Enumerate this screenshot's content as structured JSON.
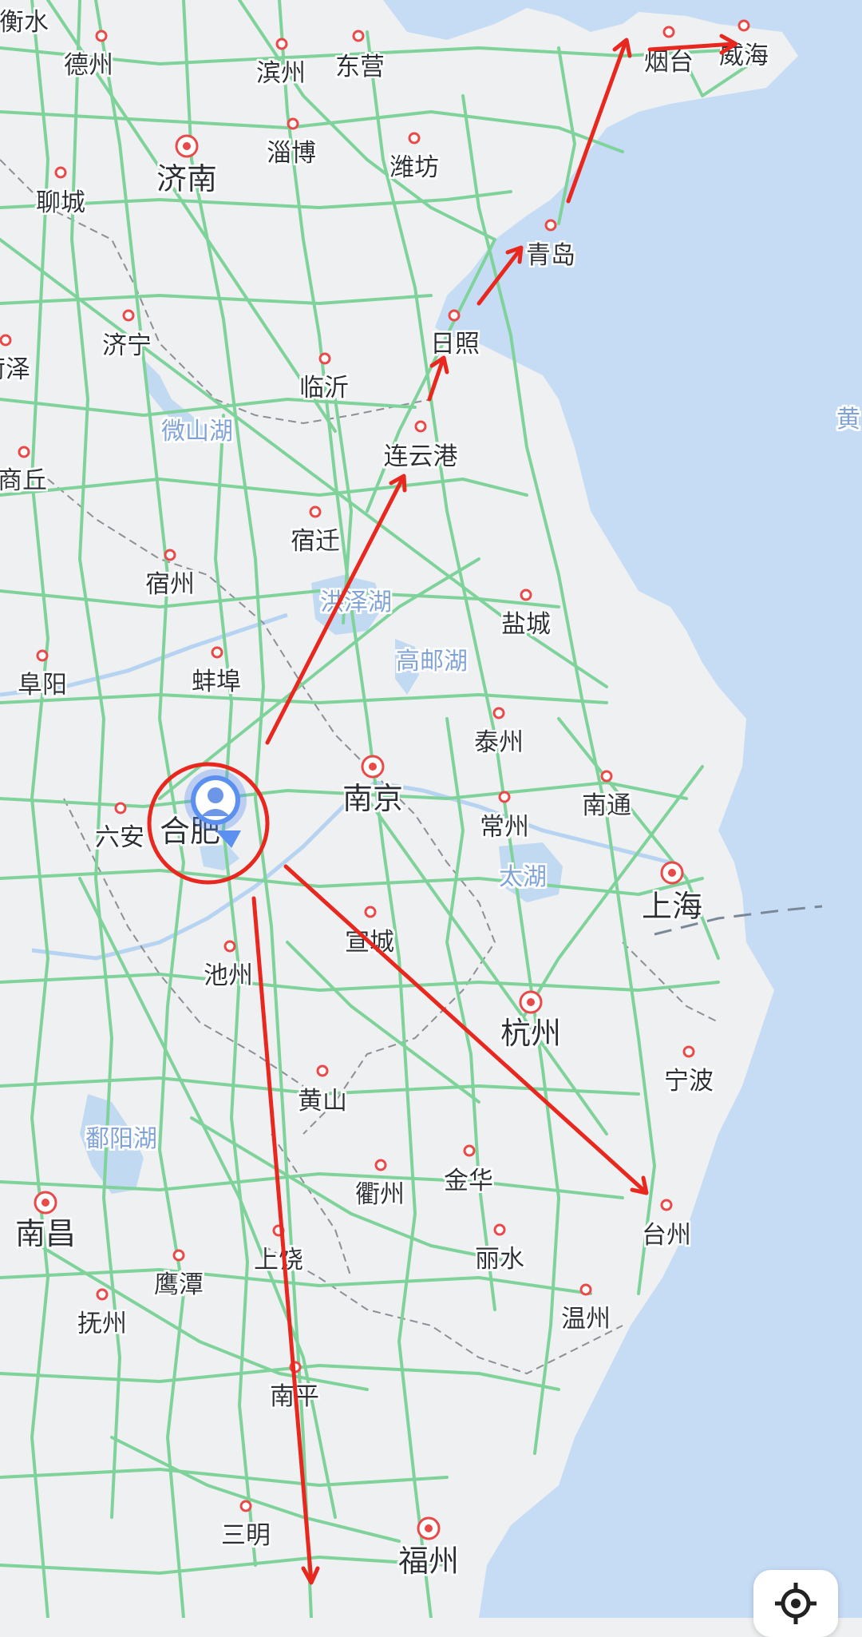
{
  "map": {
    "cities": [
      {
        "id": "hengshui",
        "label": "衡水"
      },
      {
        "id": "dezhou",
        "label": "德州"
      },
      {
        "id": "binzhou",
        "label": "滨州"
      },
      {
        "id": "dongying",
        "label": "东营"
      },
      {
        "id": "yantai",
        "label": "烟台"
      },
      {
        "id": "weihai",
        "label": "威海"
      },
      {
        "id": "jinan",
        "label": "济南"
      },
      {
        "id": "zibo",
        "label": "淄博"
      },
      {
        "id": "weifang",
        "label": "潍坊"
      },
      {
        "id": "liaocheng",
        "label": "聊城"
      },
      {
        "id": "qingdao",
        "label": "青岛"
      },
      {
        "id": "jining",
        "label": "济宁"
      },
      {
        "id": "heze",
        "label": "菏泽"
      },
      {
        "id": "rizhao",
        "label": "日照"
      },
      {
        "id": "linyi",
        "label": "临沂"
      },
      {
        "id": "lianyungang",
        "label": "连云港"
      },
      {
        "id": "shangqiu",
        "label": "商丘"
      },
      {
        "id": "suqian",
        "label": "宿迁"
      },
      {
        "id": "suzhou-ah",
        "label": "宿州"
      },
      {
        "id": "yancheng",
        "label": "盐城"
      },
      {
        "id": "fuyang",
        "label": "阜阳"
      },
      {
        "id": "bengbu",
        "label": "蚌埠"
      },
      {
        "id": "taizhou-js",
        "label": "泰州"
      },
      {
        "id": "nanjing",
        "label": "南京"
      },
      {
        "id": "nantong",
        "label": "南通"
      },
      {
        "id": "luan",
        "label": "六安"
      },
      {
        "id": "hefei",
        "label": "合肥"
      },
      {
        "id": "changzhou",
        "label": "常州"
      },
      {
        "id": "shanghai",
        "label": "上海"
      },
      {
        "id": "xuancheng",
        "label": "宣城"
      },
      {
        "id": "chizhou",
        "label": "池州"
      },
      {
        "id": "hangzhou",
        "label": "杭州"
      },
      {
        "id": "ningbo",
        "label": "宁波"
      },
      {
        "id": "huangshan",
        "label": "黄山"
      },
      {
        "id": "quzhou",
        "label": "衢州"
      },
      {
        "id": "jinhua",
        "label": "金华"
      },
      {
        "id": "taizhou-zj",
        "label": "台州"
      },
      {
        "id": "nanchang",
        "label": "南昌"
      },
      {
        "id": "shangrao",
        "label": "上饶"
      },
      {
        "id": "lishui",
        "label": "丽水"
      },
      {
        "id": "yingtan",
        "label": "鹰潭"
      },
      {
        "id": "wenzhou",
        "label": "温州"
      },
      {
        "id": "fuzhou-jx",
        "label": "抚州"
      },
      {
        "id": "nanping",
        "label": "南平"
      },
      {
        "id": "sanming",
        "label": "三明"
      },
      {
        "id": "fuzhou-fj",
        "label": "福州"
      }
    ],
    "lakes": [
      {
        "id": "weishan-lake",
        "label": "微山湖"
      },
      {
        "id": "hongze-lake",
        "label": "洪泽湖"
      },
      {
        "id": "gaoyou-lake",
        "label": "高邮湖"
      },
      {
        "id": "tai-lake",
        "label": "太湖"
      },
      {
        "id": "poyang-lake",
        "label": "鄱阳湖"
      }
    ],
    "sea_label": "黄",
    "colors": {
      "land": "#eef0f2",
      "sea": "#c6dcf5",
      "lake": "#c2d9f2",
      "highway": "#7fd39a",
      "annotation": "#e8281e",
      "city_dot": "#e84a4a",
      "user_marker": "#5b8ff0"
    },
    "user_marker_icon": "user-avatar-marker",
    "locate_icon": "crosshair-locate-icon"
  }
}
